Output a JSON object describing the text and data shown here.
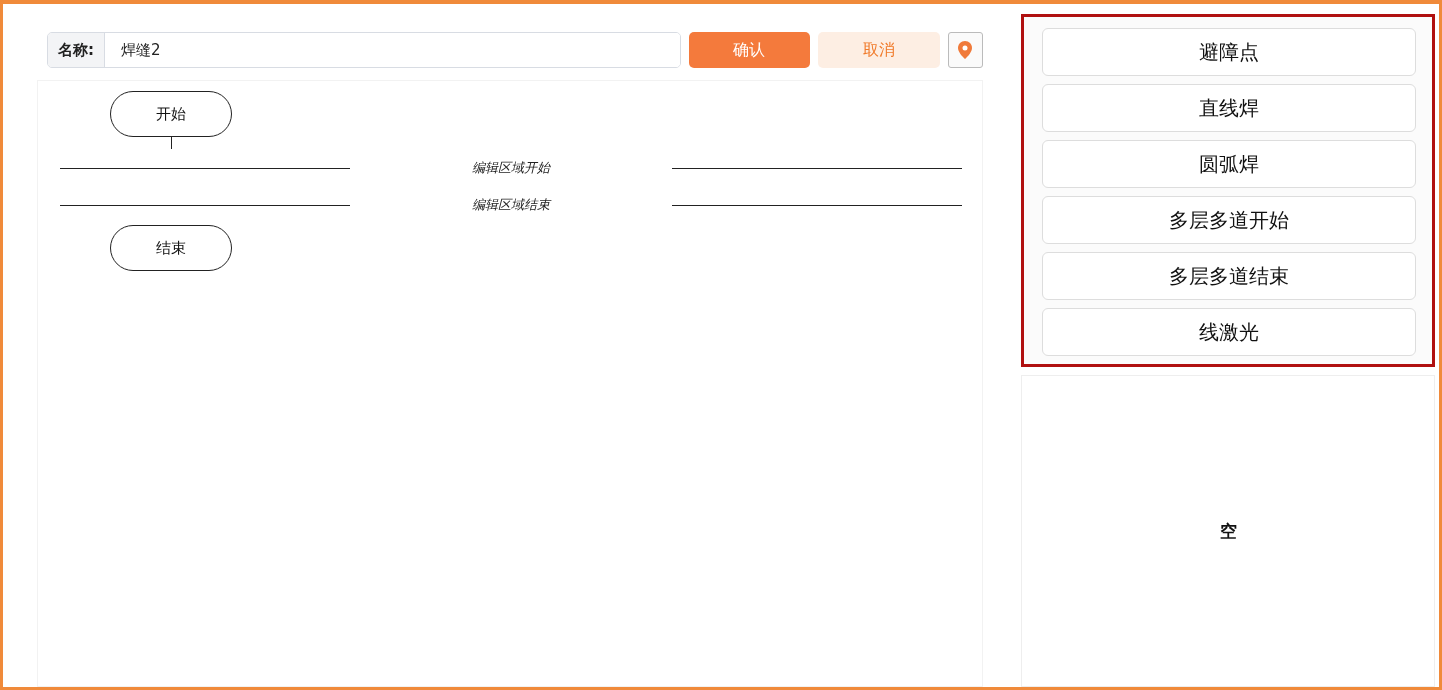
{
  "name_field": {
    "label": "名称:",
    "value": "焊缝2"
  },
  "actions": [
    {
      "label": "确认",
      "kind": "primary"
    },
    {
      "label": "取消",
      "kind": "secondary"
    }
  ],
  "flow": {
    "start": "开始",
    "region_start": "编辑区域开始",
    "region_end": "编辑区域结束",
    "end": "结束"
  },
  "palette": [
    {
      "label": "避障点"
    },
    {
      "label": "直线焊"
    },
    {
      "label": "圆弧焊"
    },
    {
      "label": "多层多道开始"
    },
    {
      "label": "多层多道结束"
    },
    {
      "label": "线激光"
    }
  ],
  "detail_panel": {
    "empty_text": "空"
  }
}
